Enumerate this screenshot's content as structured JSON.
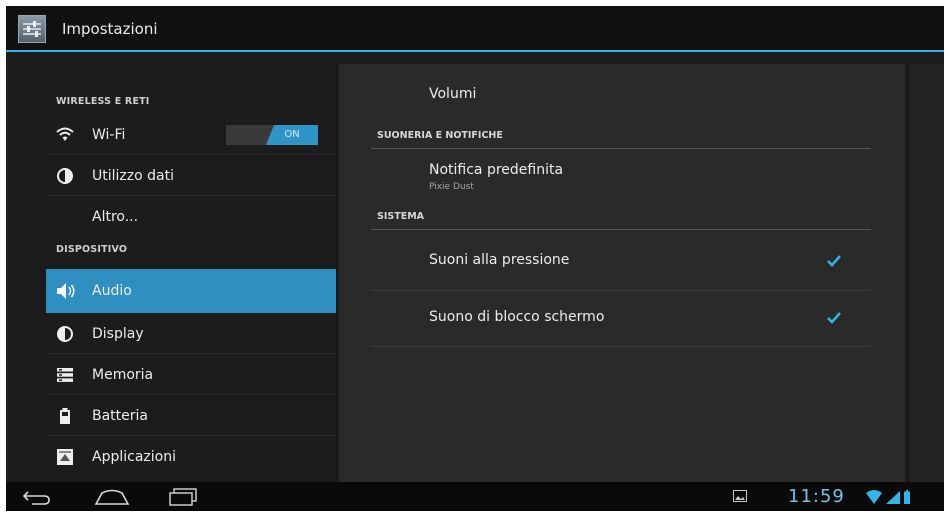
{
  "app": {
    "title": "Impostazioni",
    "icon": "settings-sliders-icon"
  },
  "sidebar": {
    "sections": [
      {
        "header": "WIRELESS E RETI"
      },
      {
        "header": "DISPOSITIVO"
      }
    ],
    "items": [
      {
        "label": "Wi-Fi",
        "icon": "wifi-icon",
        "toggle": "ON"
      },
      {
        "label": "Utilizzo dati",
        "icon": "data-usage-icon"
      },
      {
        "label": "Altro..."
      },
      {
        "label": "Audio",
        "icon": "speaker-icon",
        "selected": true
      },
      {
        "label": "Display",
        "icon": "display-brightness-icon"
      },
      {
        "label": "Memoria",
        "icon": "storage-icon"
      },
      {
        "label": "Batteria",
        "icon": "battery-icon"
      },
      {
        "label": "Applicazioni",
        "icon": "apps-icon"
      }
    ]
  },
  "detail": {
    "volumi": "Volumi",
    "suoneria_header": "SUONERIA E NOTIFICHE",
    "notifica_title": "Notifica predefinita",
    "notifica_value": "Pixie Dust",
    "sistema_header": "SISTEMA",
    "suoni_pressione": {
      "label": "Suoni alla pressione",
      "checked": true
    },
    "suono_blocco": {
      "label": "Suono di blocco schermo",
      "checked": true
    }
  },
  "status": {
    "time": "11:59"
  },
  "colors": {
    "accent": "#33b5e5",
    "selected": "#2f8fc0"
  }
}
